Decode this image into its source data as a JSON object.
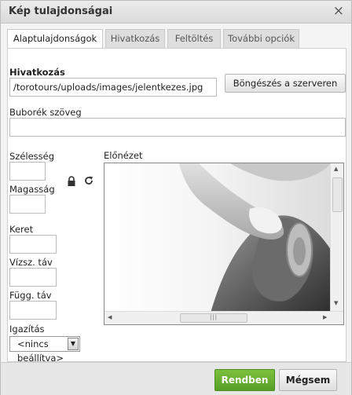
{
  "dialog": {
    "title": "Kép tulajdonságai",
    "close_symbol": "×"
  },
  "tabs": [
    {
      "label": "Alaptulajdonságok",
      "active": true
    },
    {
      "label": "Hivatkozás",
      "active": false
    },
    {
      "label": "Feltöltés",
      "active": false
    },
    {
      "label": "További opciók",
      "active": false
    }
  ],
  "url": {
    "label": "Hivatkozás",
    "value": "/torotours/uploads/images/jelentkezes.jpg",
    "browse_label": "Böngészés a szerveren"
  },
  "tooltip": {
    "label": "Buborék szöveg",
    "value": ""
  },
  "dimensions": {
    "width_label": "Szélesség",
    "width_value": "",
    "height_label": "Magasság",
    "height_value": ""
  },
  "border": {
    "label": "Keret",
    "value": ""
  },
  "hspace": {
    "label": "Vízsz. táv",
    "value": ""
  },
  "vspace": {
    "label": "Függ. táv",
    "value": ""
  },
  "align": {
    "label": "Igazítás",
    "selected": "<nincs beállítva>"
  },
  "preview": {
    "label": "Előnézet"
  },
  "footer": {
    "ok_label": "Rendben",
    "cancel_label": "Mégsem"
  },
  "colors": {
    "ok_button": "#5ca82b"
  },
  "icons": {
    "lock": "lock-icon",
    "reset": "reset-size-icon"
  }
}
